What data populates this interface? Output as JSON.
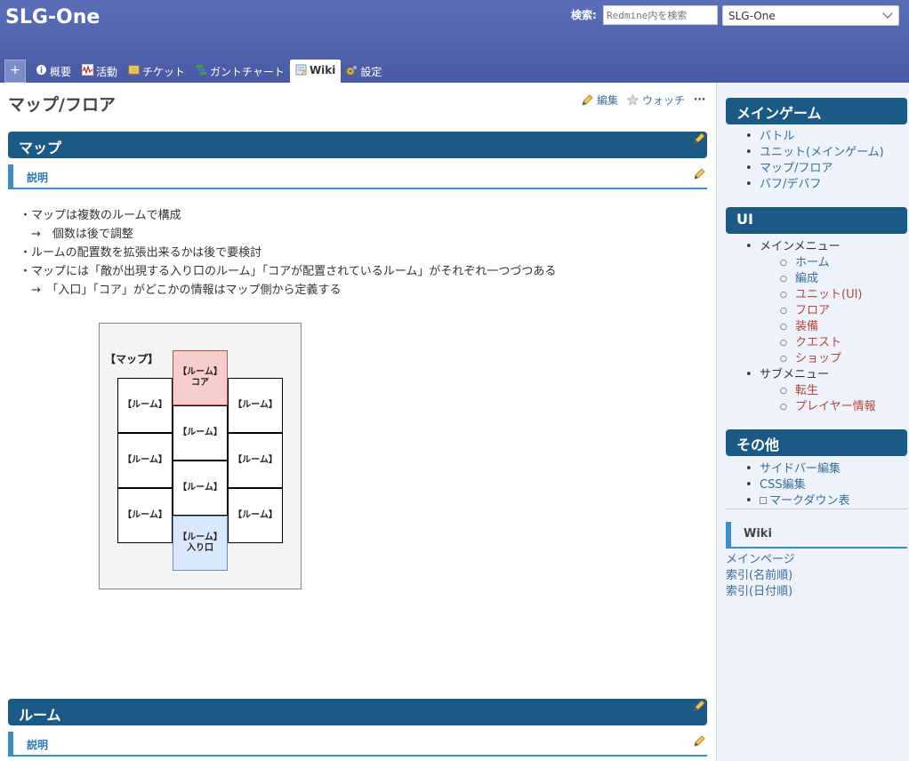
{
  "header": {
    "app_title": "SLG-One",
    "search_label": "検索:",
    "search_placeholder": "Redmine内を検索",
    "project_select": "SLG-One"
  },
  "tabs": [
    {
      "label": "+",
      "icon": "plus-icon"
    },
    {
      "label": "概要",
      "icon": "info-icon"
    },
    {
      "label": "活動",
      "icon": "activity-icon"
    },
    {
      "label": "チケット",
      "icon": "ticket-icon"
    },
    {
      "label": "ガントチャート",
      "icon": "gantt-icon"
    },
    {
      "label": "Wiki",
      "icon": "wiki-icon",
      "active": true
    },
    {
      "label": "設定",
      "icon": "settings-icon"
    }
  ],
  "page": {
    "title": "マップ/フロア",
    "actions": {
      "edit": "編集",
      "watch": "ウォッチ",
      "more": "⋯"
    },
    "section1": "マップ",
    "sub1": "説明",
    "lines": [
      "・マップは複数のルームで構成",
      "　→　個数は後で調整",
      "・ルームの配置数を拡張出来るかは後で要検討",
      "・マップには「敵が出現する入り口のルーム」「コアが配置されているルーム」がそれぞれ一つづつある",
      "　→　「入口」「コア」がどこかの情報はマップ側から定義する"
    ],
    "section2": "ルーム",
    "sub2": "説明"
  },
  "diagram": {
    "label": "【マップ】",
    "room": "【ルーム】",
    "core_room": "【ルーム】コア",
    "core_line1": "【ルーム】",
    "core_line2": "コア",
    "entry_line1": "【ルーム】",
    "entry_line2": "入り口",
    "core_color": "#f8cecc",
    "entry_color": "#dae8fc"
  },
  "sidebar": {
    "main_game": {
      "title": "メインゲーム",
      "items": [
        "バトル",
        "ユニット(メインゲーム)",
        "マップ/フロア",
        "バフ/デバフ"
      ]
    },
    "ui": {
      "title": "UI",
      "main_menu": "メインメニュー",
      "main_menu_items": [
        "ホーム",
        "編成",
        "ユニット(UI)",
        "フロア",
        "装備",
        "クエスト",
        "ショップ"
      ],
      "sub_menu": "サブメニュー",
      "sub_menu_items": [
        "転生",
        "プレイヤー情報"
      ]
    },
    "other": {
      "title": "その他",
      "items": [
        "サイドバー編集",
        "CSS編集",
        "マークダウン表"
      ]
    },
    "wiki": {
      "title": "Wiki",
      "links": [
        "メインページ",
        "索引(名前順)",
        "索引(日付順)"
      ]
    }
  },
  "colors": {
    "header": "#5064b0",
    "heading_bar": "#1c5a86",
    "accent": "#3a8fc7",
    "link": "#3b6d9a",
    "missing_link": "#b5473a"
  }
}
